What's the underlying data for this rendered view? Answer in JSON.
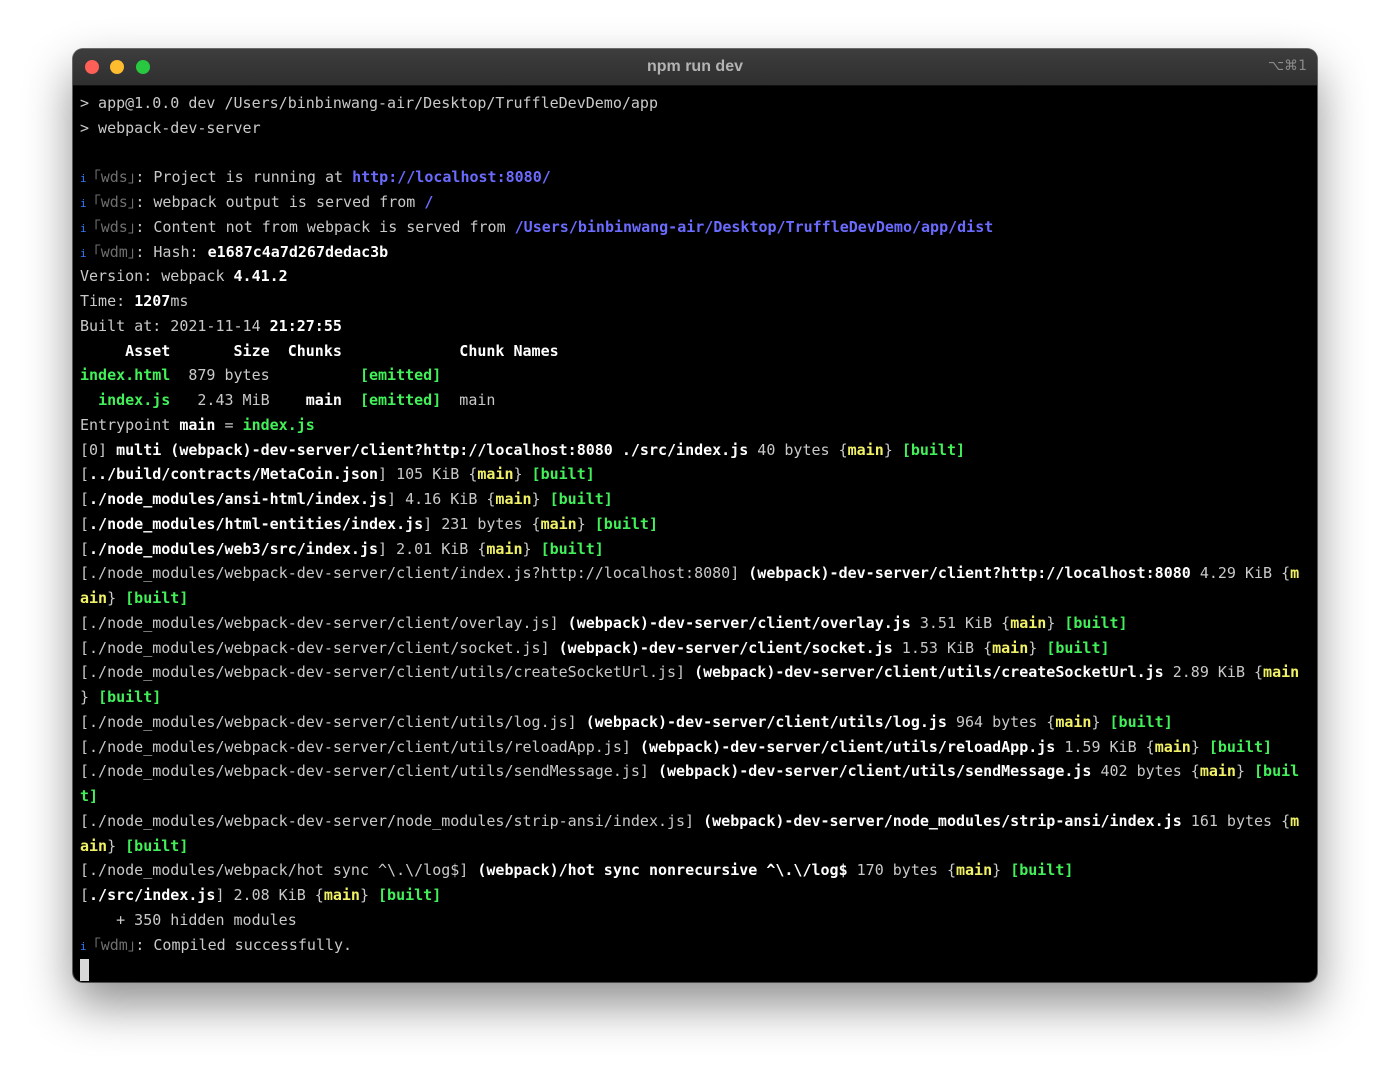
{
  "window": {
    "title": "npm run dev",
    "shortcut": "⌥⌘1"
  },
  "terminal": {
    "lines": [
      [
        {
          "t": "> app@1.0.0 dev /Users/binbinwang-air/Desktop/TruffleDevDemo/app"
        }
      ],
      [
        {
          "t": "> webpack-dev-server"
        }
      ],
      [],
      [
        {
          "t": "i ",
          "c": "i"
        },
        {
          "t": "｢wds｣",
          "c": "d"
        },
        {
          "t": ": Project is running at "
        },
        {
          "t": "http://localhost:8080/",
          "c": "u"
        }
      ],
      [
        {
          "t": "i ",
          "c": "i"
        },
        {
          "t": "｢wds｣",
          "c": "d"
        },
        {
          "t": ": webpack output is served from "
        },
        {
          "t": "/",
          "c": "u"
        }
      ],
      [
        {
          "t": "i ",
          "c": "i"
        },
        {
          "t": "｢wds｣",
          "c": "d"
        },
        {
          "t": ": Content not from webpack is served from "
        },
        {
          "t": "/Users/binbinwang-air/Desktop/TruffleDevDemo/app/dist",
          "c": "u"
        }
      ],
      [
        {
          "t": "i ",
          "c": "i"
        },
        {
          "t": "｢wdm｣",
          "c": "d"
        },
        {
          "t": ": Hash: "
        },
        {
          "t": "e1687c4a7d267dedac3b",
          "c": "b"
        }
      ],
      [
        {
          "t": "Version: webpack "
        },
        {
          "t": "4.41.2",
          "c": "b"
        }
      ],
      [
        {
          "t": "Time: "
        },
        {
          "t": "1207",
          "c": "b"
        },
        {
          "t": "ms"
        }
      ],
      [
        {
          "t": "Built at: 2021-11-14 "
        },
        {
          "t": "21:27:55",
          "c": "b"
        }
      ],
      [
        {
          "t": "     Asset       Size  Chunks             Chunk Names",
          "c": "b"
        }
      ],
      [
        {
          "t": "index.html",
          "c": "g"
        },
        {
          "t": "  879 bytes          "
        },
        {
          "t": "[emitted]",
          "c": "g"
        }
      ],
      [
        {
          "t": "  "
        },
        {
          "t": "index.js",
          "c": "g"
        },
        {
          "t": "   2.43 MiB    "
        },
        {
          "t": "main",
          "c": "b"
        },
        {
          "t": "  "
        },
        {
          "t": "[emitted]",
          "c": "g"
        },
        {
          "t": "  main"
        }
      ],
      [
        {
          "t": "Entrypoint "
        },
        {
          "t": "main",
          "c": "b"
        },
        {
          "t": " = "
        },
        {
          "t": "index.js",
          "c": "g"
        }
      ],
      [
        {
          "t": "[0] "
        },
        {
          "t": "multi (webpack)-dev-server/client?http://localhost:8080 ./src/index.js",
          "c": "b"
        },
        {
          "t": " 40 bytes {"
        },
        {
          "t": "main",
          "c": "y"
        },
        {
          "t": "} "
        },
        {
          "t": "[built]",
          "c": "g"
        }
      ],
      [
        {
          "t": "["
        },
        {
          "t": "../build/contracts/MetaCoin.json",
          "c": "b"
        },
        {
          "t": "] 105 KiB {"
        },
        {
          "t": "main",
          "c": "y"
        },
        {
          "t": "} "
        },
        {
          "t": "[built]",
          "c": "g"
        }
      ],
      [
        {
          "t": "["
        },
        {
          "t": "./node_modules/ansi-html/index.js",
          "c": "b"
        },
        {
          "t": "] 4.16 KiB {"
        },
        {
          "t": "main",
          "c": "y"
        },
        {
          "t": "} "
        },
        {
          "t": "[built]",
          "c": "g"
        }
      ],
      [
        {
          "t": "["
        },
        {
          "t": "./node_modules/html-entities/index.js",
          "c": "b"
        },
        {
          "t": "] 231 bytes {"
        },
        {
          "t": "main",
          "c": "y"
        },
        {
          "t": "} "
        },
        {
          "t": "[built]",
          "c": "g"
        }
      ],
      [
        {
          "t": "["
        },
        {
          "t": "./node_modules/web3/src/index.js",
          "c": "b"
        },
        {
          "t": "] 2.01 KiB {"
        },
        {
          "t": "main",
          "c": "y"
        },
        {
          "t": "} "
        },
        {
          "t": "[built]",
          "c": "g"
        }
      ],
      [
        {
          "t": "[./node_modules/webpack-dev-server/client/index.js?http://localhost:8080] "
        },
        {
          "t": "(webpack)-dev-server/client?http://localhost:8080",
          "c": "b"
        },
        {
          "t": " 4.29 KiB {"
        },
        {
          "t": "m",
          "c": "y"
        }
      ],
      [
        {
          "t": "ain",
          "c": "y"
        },
        {
          "t": "} "
        },
        {
          "t": "[built]",
          "c": "g"
        }
      ],
      [
        {
          "t": "[./node_modules/webpack-dev-server/client/overlay.js] "
        },
        {
          "t": "(webpack)-dev-server/client/overlay.js",
          "c": "b"
        },
        {
          "t": " 3.51 KiB {"
        },
        {
          "t": "main",
          "c": "y"
        },
        {
          "t": "} "
        },
        {
          "t": "[built]",
          "c": "g"
        }
      ],
      [
        {
          "t": "[./node_modules/webpack-dev-server/client/socket.js] "
        },
        {
          "t": "(webpack)-dev-server/client/socket.js",
          "c": "b"
        },
        {
          "t": " 1.53 KiB {"
        },
        {
          "t": "main",
          "c": "y"
        },
        {
          "t": "} "
        },
        {
          "t": "[built]",
          "c": "g"
        }
      ],
      [
        {
          "t": "[./node_modules/webpack-dev-server/client/utils/createSocketUrl.js] "
        },
        {
          "t": "(webpack)-dev-server/client/utils/createSocketUrl.js",
          "c": "b"
        },
        {
          "t": " 2.89 KiB {"
        },
        {
          "t": "main",
          "c": "y"
        }
      ],
      [
        {
          "t": "} "
        },
        {
          "t": "[built]",
          "c": "g"
        }
      ],
      [
        {
          "t": "[./node_modules/webpack-dev-server/client/utils/log.js] "
        },
        {
          "t": "(webpack)-dev-server/client/utils/log.js",
          "c": "b"
        },
        {
          "t": " 964 bytes {"
        },
        {
          "t": "main",
          "c": "y"
        },
        {
          "t": "} "
        },
        {
          "t": "[built]",
          "c": "g"
        }
      ],
      [
        {
          "t": "[./node_modules/webpack-dev-server/client/utils/reloadApp.js] "
        },
        {
          "t": "(webpack)-dev-server/client/utils/reloadApp.js",
          "c": "b"
        },
        {
          "t": " 1.59 KiB {"
        },
        {
          "t": "main",
          "c": "y"
        },
        {
          "t": "} "
        },
        {
          "t": "[built]",
          "c": "g"
        }
      ],
      [
        {
          "t": "[./node_modules/webpack-dev-server/client/utils/sendMessage.js] "
        },
        {
          "t": "(webpack)-dev-server/client/utils/sendMessage.js",
          "c": "b"
        },
        {
          "t": " 402 bytes {"
        },
        {
          "t": "main",
          "c": "y"
        },
        {
          "t": "} "
        },
        {
          "t": "[buil",
          "c": "g"
        }
      ],
      [
        {
          "t": "t]",
          "c": "g"
        }
      ],
      [
        {
          "t": "[./node_modules/webpack-dev-server/node_modules/strip-ansi/index.js] "
        },
        {
          "t": "(webpack)-dev-server/node_modules/strip-ansi/index.js",
          "c": "b"
        },
        {
          "t": " 161 bytes {"
        },
        {
          "t": "m",
          "c": "y"
        }
      ],
      [
        {
          "t": "ain",
          "c": "y"
        },
        {
          "t": "} "
        },
        {
          "t": "[built]",
          "c": "g"
        }
      ],
      [
        {
          "t": "[./node_modules/webpack/hot sync ^\\.\\/log$] "
        },
        {
          "t": "(webpack)/hot sync nonrecursive ^\\.\\/log$",
          "c": "b"
        },
        {
          "t": " 170 bytes {"
        },
        {
          "t": "main",
          "c": "y"
        },
        {
          "t": "} "
        },
        {
          "t": "[built]",
          "c": "g"
        }
      ],
      [
        {
          "t": "["
        },
        {
          "t": "./src/index.js",
          "c": "b"
        },
        {
          "t": "] 2.08 KiB {"
        },
        {
          "t": "main",
          "c": "y"
        },
        {
          "t": "} "
        },
        {
          "t": "[built]",
          "c": "g"
        }
      ],
      [
        {
          "t": "    + 350 hidden modules"
        }
      ],
      [
        {
          "t": "i ",
          "c": "i"
        },
        {
          "t": "｢wdm｣",
          "c": "d"
        },
        {
          "t": ": Compiled successfully."
        }
      ]
    ]
  }
}
